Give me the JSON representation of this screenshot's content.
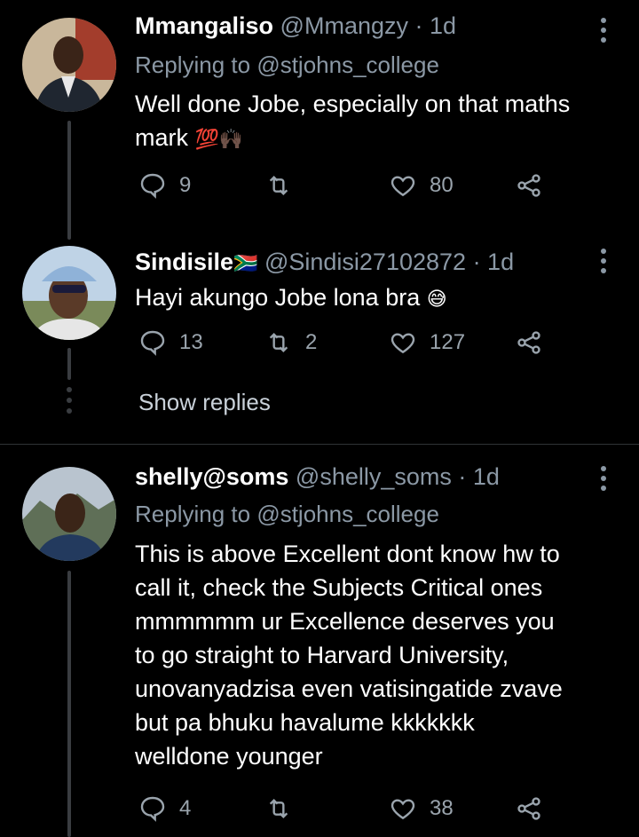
{
  "tweets": [
    {
      "name": "Mmangaliso",
      "handle": "@Mmangzy",
      "time": "· 1d",
      "replying_prefix": "Replying to",
      "replying_to": "@stjohns_college",
      "text_lines": [
        "Well done Jobe, especially on that maths",
        "mark"
      ],
      "emoji": "💯🙌🏿",
      "replies": "9",
      "retweets": "",
      "likes": "80"
    },
    {
      "name": "Sindisile",
      "flag": "🇿🇦",
      "handle": "@Sindisi27102872",
      "time": "· 1d",
      "text_lines": [
        "Hayi akungo Jobe lona bra"
      ],
      "emoji": "😅",
      "replies": "13",
      "retweets": "2",
      "likes": "127"
    },
    {
      "name": "shelly@soms",
      "handle": "@shelly_soms",
      "time": "· 1d",
      "replying_prefix": "Replying to",
      "replying_to": "@stjohns_college",
      "text_lines": [
        "This is above Excellent dont know hw to",
        "call it, check the Subjects Critical ones",
        "mmmmmm ur Excellence deserves you",
        "to go straight to Harvard University,",
        "unovanyadzisa even vatisingatide zvave",
        "but pa bhuku havalume kkkkkkk",
        "welldone younger"
      ],
      "replies": "4",
      "retweets": "",
      "likes": "38"
    }
  ],
  "show_replies": "Show replies",
  "colors": {
    "background": "#000000",
    "text": "#e7e9ea",
    "secondary": "#8b98a5",
    "divider": "#2f3336"
  },
  "icons": [
    "reply-icon",
    "retweet-icon",
    "like-icon",
    "share-icon",
    "more-icon"
  ]
}
